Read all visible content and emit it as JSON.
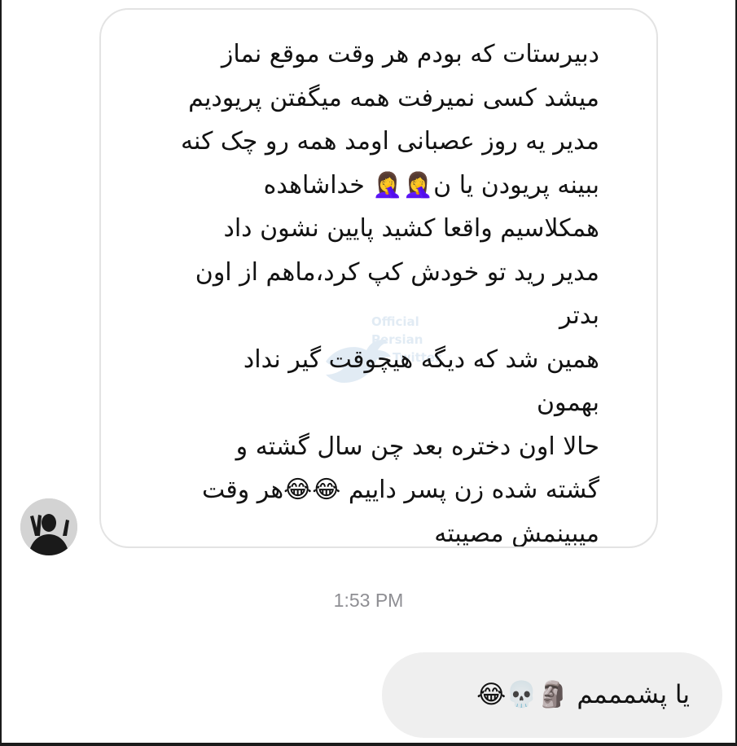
{
  "incoming_message": {
    "lines": [
      "دبیرستات که بودم هر وقت موقع نماز",
      "میشد کسی نمیرفت همه میگفتن پریودیم",
      "مدیر یه روز عصبانی اومد همه رو چک کنه",
      "ببینه پریودن یا ن",
      "همکلاسیم واقعا کشید پایین نشون داد",
      "مدیر رید تو خودش کپ کرد،ماهم از اون",
      "بدتر",
      "همین شد که دیگه هیچوقت گیر نداد",
      "بهمون",
      "حالا اون دختره بعد چن سال گشته و",
      "گشته شده زن پسر داییم",
      "میبینمش مصیبته"
    ],
    "line4_emoji": "🤦‍♀️🤦‍♀️",
    "line4_suffix": "خداشاهده",
    "line11_emoji": "😂😂",
    "line11_suffix": "هر وقت"
  },
  "watermark": {
    "text_line1": "Official",
    "text_line2": "Persian",
    "text_line3": "Twitter"
  },
  "timestamp": "1:53 PM",
  "outgoing_message": {
    "text": "یا پشمممم",
    "emojis": "🗿💀😂"
  },
  "colors": {
    "bubble_border": "#e3e3e3",
    "outgoing_bubble": "#efefef",
    "timestamp": "#8e8e93",
    "text": "#121212"
  }
}
